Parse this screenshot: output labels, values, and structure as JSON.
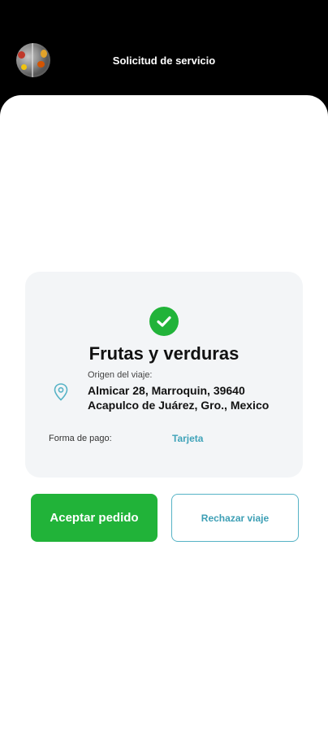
{
  "header": {
    "title": "Solicitud de servicio",
    "avatar_icon": "profile-photo"
  },
  "card": {
    "status_icon": "check-circle-icon",
    "status_color": "#21b339",
    "title": "Frutas y verduras",
    "origin": {
      "icon": "location-pin-icon",
      "label": "Origen del viaje:",
      "address_line1": "Almicar 28, Marroquin, 39640",
      "address_line2": "Acapulco de Juárez, Gro., Mexico"
    },
    "payment": {
      "label": "Forma de pago:",
      "value": "Tarjeta"
    }
  },
  "actions": {
    "accept_label": "Aceptar pedido",
    "reject_label": "Rechazar viaje",
    "accept_color": "#21b339",
    "reject_color": "#3d9fb5"
  }
}
